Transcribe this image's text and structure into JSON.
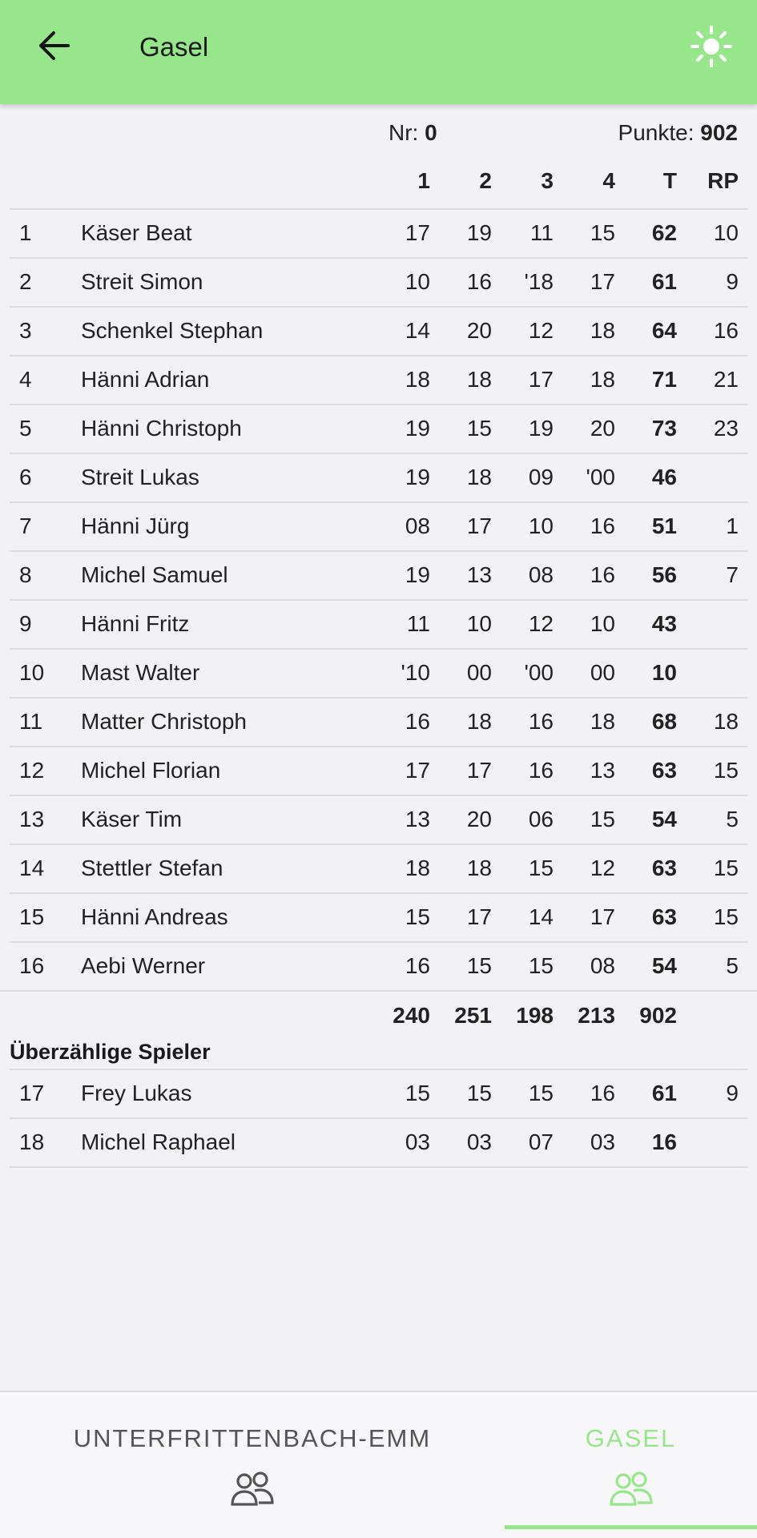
{
  "app_bar": {
    "title": "Gasel",
    "back_icon": "arrow-left-icon",
    "theme_icon": "sun-icon"
  },
  "info": {
    "nr_label": "Nr:",
    "nr_value": "0",
    "punkte_label": "Punkte:",
    "punkte_value": "902"
  },
  "columns": [
    "1",
    "2",
    "3",
    "4",
    "T",
    "RP"
  ],
  "players": [
    {
      "rank": "1",
      "name": "Käser Beat",
      "s1": "17",
      "s2": "19",
      "s3": "11",
      "s4": "15",
      "t": "62",
      "rp": "10"
    },
    {
      "rank": "2",
      "name": "Streit Simon",
      "s1": "10",
      "s2": "16",
      "s3": "'18",
      "s4": "17",
      "t": "61",
      "rp": "9"
    },
    {
      "rank": "3",
      "name": "Schenkel Stephan",
      "s1": "14",
      "s2": "20",
      "s3": "12",
      "s4": "18",
      "t": "64",
      "rp": "16"
    },
    {
      "rank": "4",
      "name": "Hänni Adrian",
      "s1": "18",
      "s2": "18",
      "s3": "17",
      "s4": "18",
      "t": "71",
      "rp": "21"
    },
    {
      "rank": "5",
      "name": "Hänni Christoph",
      "s1": "19",
      "s2": "15",
      "s3": "19",
      "s4": "20",
      "t": "73",
      "rp": "23"
    },
    {
      "rank": "6",
      "name": "Streit Lukas",
      "s1": "19",
      "s2": "18",
      "s3": "09",
      "s4": "'00",
      "t": "46",
      "rp": ""
    },
    {
      "rank": "7",
      "name": "Hänni Jürg",
      "s1": "08",
      "s2": "17",
      "s3": "10",
      "s4": "16",
      "t": "51",
      "rp": "1"
    },
    {
      "rank": "8",
      "name": "Michel Samuel",
      "s1": "19",
      "s2": "13",
      "s3": "08",
      "s4": "16",
      "t": "56",
      "rp": "7"
    },
    {
      "rank": "9",
      "name": "Hänni Fritz",
      "s1": "11",
      "s2": "10",
      "s3": "12",
      "s4": "10",
      "t": "43",
      "rp": ""
    },
    {
      "rank": "10",
      "name": "Mast Walter",
      "s1": "'10",
      "s2": "00",
      "s3": "'00",
      "s4": "00",
      "t": "10",
      "rp": ""
    },
    {
      "rank": "11",
      "name": "Matter Christoph",
      "s1": "16",
      "s2": "18",
      "s3": "16",
      "s4": "18",
      "t": "68",
      "rp": "18"
    },
    {
      "rank": "12",
      "name": "Michel Florian",
      "s1": "17",
      "s2": "17",
      "s3": "16",
      "s4": "13",
      "t": "63",
      "rp": "15"
    },
    {
      "rank": "13",
      "name": "Käser Tim",
      "s1": "13",
      "s2": "20",
      "s3": "06",
      "s4": "15",
      "t": "54",
      "rp": "5"
    },
    {
      "rank": "14",
      "name": "Stettler Stefan",
      "s1": "18",
      "s2": "18",
      "s3": "15",
      "s4": "12",
      "t": "63",
      "rp": "15"
    },
    {
      "rank": "15",
      "name": "Hänni Andreas",
      "s1": "15",
      "s2": "17",
      "s3": "14",
      "s4": "17",
      "t": "63",
      "rp": "15"
    },
    {
      "rank": "16",
      "name": "Aebi Werner",
      "s1": "16",
      "s2": "15",
      "s3": "15",
      "s4": "08",
      "t": "54",
      "rp": "5"
    }
  ],
  "totals": {
    "s1": "240",
    "s2": "251",
    "s3": "198",
    "s4": "213",
    "t": "902"
  },
  "extra_section_title": "Überzählige Spieler",
  "extra_players": [
    {
      "rank": "17",
      "name": "Frey Lukas",
      "s1": "15",
      "s2": "15",
      "s3": "15",
      "s4": "16",
      "t": "61",
      "rp": "9"
    },
    {
      "rank": "18",
      "name": "Michel Raphael",
      "s1": "03",
      "s2": "03",
      "s3": "07",
      "s4": "03",
      "t": "16",
      "rp": ""
    }
  ],
  "bottom_nav": {
    "tabs": [
      {
        "label": "UNTERFRITTENBACH-EMM",
        "icon": "group-icon",
        "selected": false
      },
      {
        "label": "GASEL",
        "icon": "group-icon",
        "selected": true
      }
    ],
    "accent_color": "#98e68b"
  }
}
